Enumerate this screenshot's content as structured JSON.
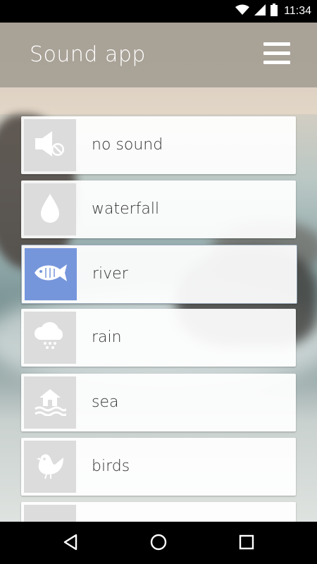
{
  "status_bar": {
    "time": "11:34",
    "icons": [
      "signal-icon",
      "wifi-icon",
      "battery-icon"
    ]
  },
  "app_bar": {
    "title": "Sound app",
    "menu_icon": "hamburger-menu-icon"
  },
  "sounds": [
    {
      "label": "no sound",
      "icon": "muted-speaker-icon",
      "selected": false
    },
    {
      "label": "waterfall",
      "icon": "water-drop-icon",
      "selected": false
    },
    {
      "label": "river",
      "icon": "fish-icon",
      "selected": true
    },
    {
      "label": "rain",
      "icon": "rain-cloud-icon",
      "selected": false
    },
    {
      "label": "sea",
      "icon": "sea-hut-icon",
      "selected": false
    },
    {
      "label": "birds",
      "icon": "bird-icon",
      "selected": false
    },
    {
      "label": "",
      "icon": "unknown-icon",
      "selected": false
    }
  ],
  "colors": {
    "selected_tile": "#7696dc",
    "tile": "#dcdcdc",
    "icon": "#ffffff"
  },
  "nav_bar": {
    "buttons": [
      "back-icon",
      "home-icon",
      "recents-icon"
    ]
  }
}
